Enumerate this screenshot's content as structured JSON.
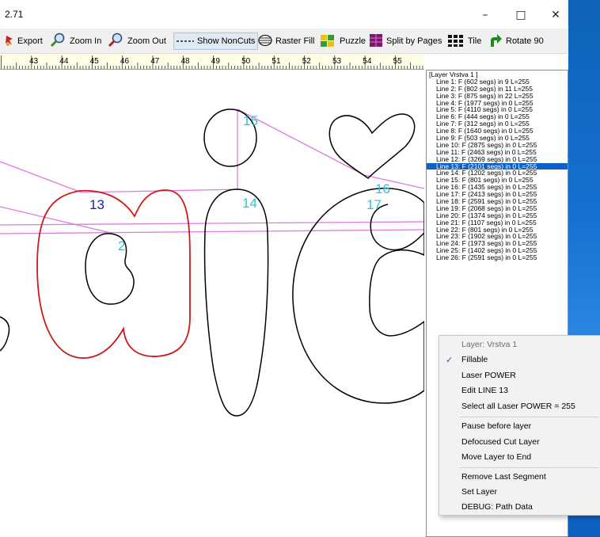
{
  "window": {
    "title": "2.71",
    "controls": {
      "minimize": "–",
      "maximize": "□",
      "close": "✕"
    }
  },
  "toolbar": [
    {
      "id": "export",
      "label": "Export",
      "icon": "export-icon"
    },
    {
      "id": "zoom-in",
      "label": "Zoom In",
      "icon": "zoom-in-icon"
    },
    {
      "id": "zoom-out",
      "label": "Zoom Out",
      "icon": "zoom-out-icon"
    },
    {
      "id": "show-noncuts",
      "label": "Show NonCuts",
      "icon": "dashed-line-icon"
    },
    {
      "id": "raster-fill",
      "label": "Raster Fill",
      "icon": "raster-fill-icon"
    },
    {
      "id": "puzzle",
      "label": "Puzzle",
      "icon": "puzzle-icon"
    },
    {
      "id": "split-by-pages",
      "label": "Split by Pages",
      "icon": "split-pages-icon"
    },
    {
      "id": "tile",
      "label": "Tile",
      "icon": "tile-icon"
    },
    {
      "id": "rotate-90",
      "label": "Rotate 90",
      "icon": "rotate-icon"
    }
  ],
  "ruler": {
    "ticks": [
      "43",
      "44",
      "45",
      "46",
      "47",
      "48",
      "49",
      "50",
      "51",
      "52",
      "53",
      "54",
      "55"
    ]
  },
  "canvas": {
    "labels": {
      "13": "13",
      "2": "2",
      "14": "14",
      "15": "15",
      "16": "16",
      "17": "17"
    },
    "colors": {
      "outline": "#000000",
      "selected": "#cc1b1b",
      "travel": "#e07be0",
      "label_blue": "#1a22a8",
      "label_cyan": "#2bc4d8"
    }
  },
  "layer_panel": {
    "header": "[Layer Vrstva 1 ]",
    "selected_index": 12,
    "lines": [
      "Line 1: F (602 segs) in 9 L=255",
      "Line 2: F (802 segs) in 11 L=255",
      "Line 3: F (875 segs) in 22 L=255",
      "Line 4: F (1977 segs) in 0 L=255",
      "Line 5: F (4110 segs) in 0 L=255",
      "Line 6: F (444 segs) in 0 L=255",
      "Line 7: F (312 segs) in 0 L=255",
      "Line 8: F (1640 segs) in 0 L=255",
      "Line 9: F (503 segs) in 0 L=255",
      "Line 10: F (2875 segs) in 0 L=255",
      "Line 11: F (2463 segs) in 0 L=255",
      "Line 12: F (3269 segs) in 0 L=255",
      "Line 13: F (2101 segs) in 0 L=255",
      "Line 14: F (1202 segs) in 0 L=255",
      "Line 15: F (801 segs) in 0 L=255",
      "Line 16: F (1435 segs) in 0 L=255",
      "Line 17: F (2413 segs) in 0 L=255",
      "Line 18: F (2591 segs) in 0 L=255",
      "Line 19: F (2068 segs) in 0 L=255",
      "Line 20: F (1374 segs) in 0 L=255",
      "Line 21: F (1107 segs) in 0 L=255",
      "Line 22: F (801 segs) in 0 L=255",
      "Line 23: F (1902 segs) in 0 L=255",
      "Line 24: F (1973 segs) in 0 L=255",
      "Line 25: F (1402 segs) in 0 L=255",
      "Line 26: F (2591 segs) in 0 L=255"
    ]
  },
  "context_menu": {
    "layer_label": "Layer: Vrstva 1",
    "fillable": "Fillable",
    "fillable_checked": true,
    "check_mark": "✓",
    "laser_power": "Laser POWER",
    "edit_line": "Edit LINE 13",
    "select_all": "Select all Laser POWER = 255",
    "pause_before": "Pause before layer",
    "defocused": "Defocused Cut Layer",
    "move_to_end": "Move Layer to End",
    "remove_last": "Remove Last Segment",
    "set_layer": "Set Layer",
    "debug": "DEBUG: Path Data"
  }
}
